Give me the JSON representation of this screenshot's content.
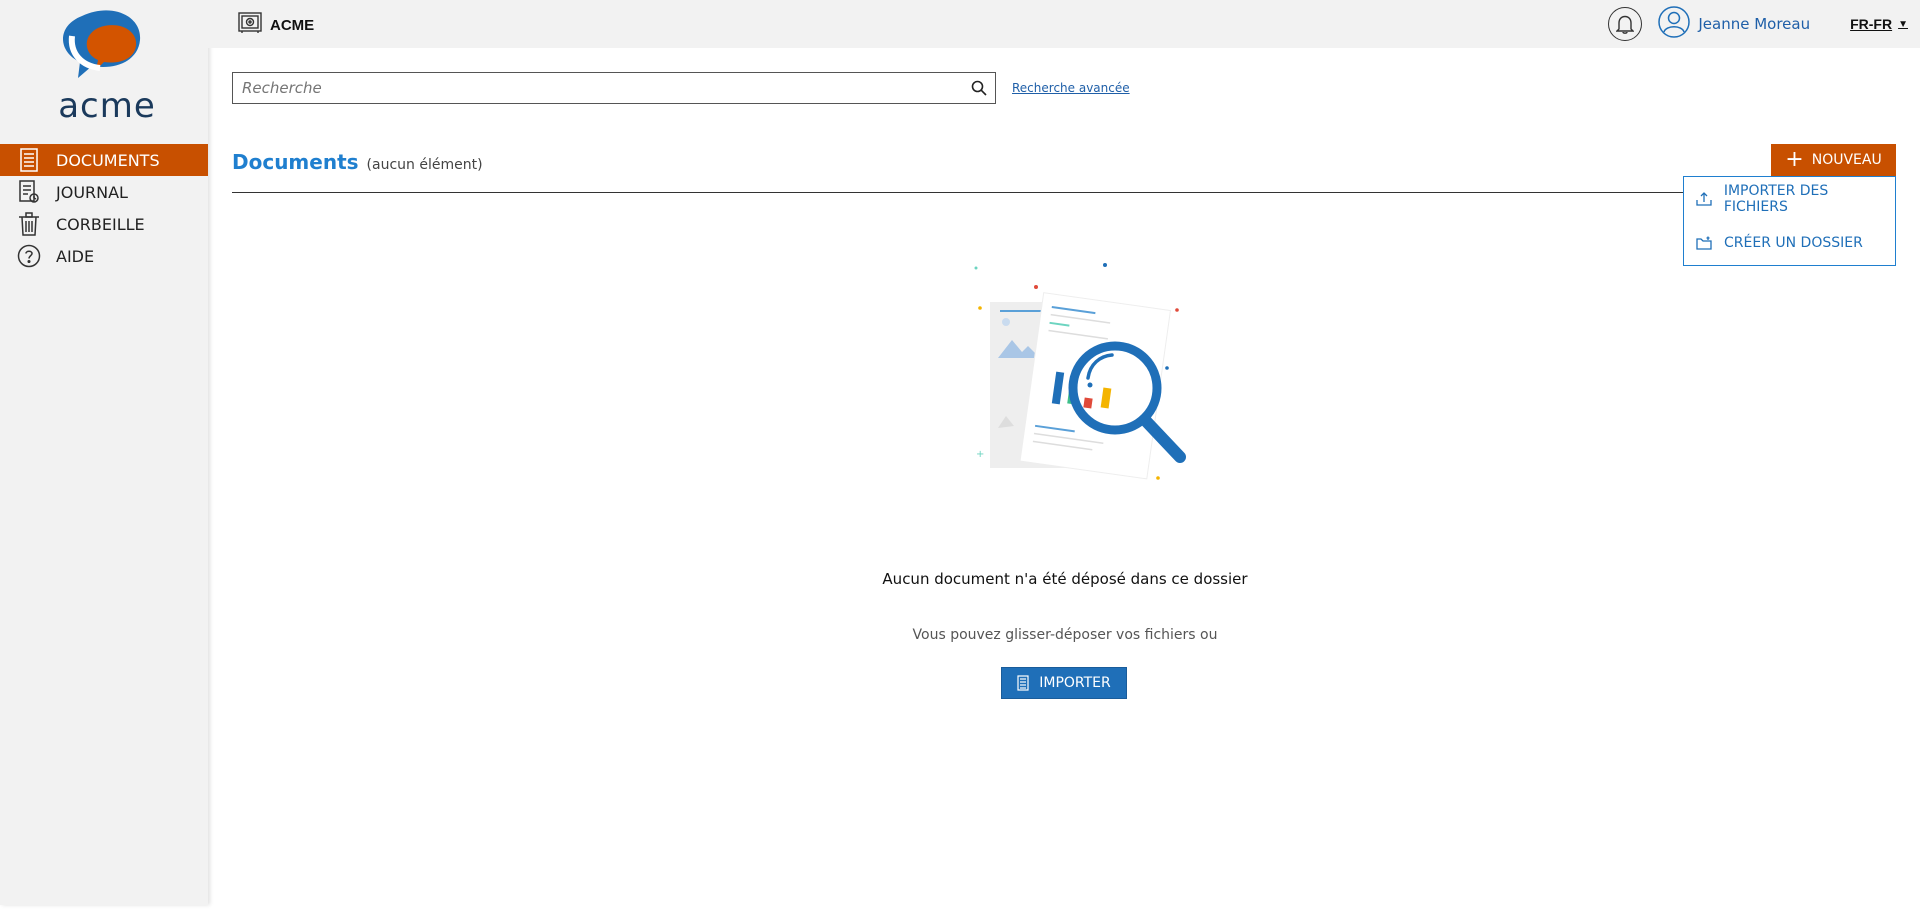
{
  "colors": {
    "accent": "#c85000",
    "primary": "#1f6fb8",
    "title": "#1f7fcf",
    "sidebar_bg": "#f2f2f2"
  },
  "logo": {
    "text": "acme"
  },
  "sidebar": {
    "items": [
      {
        "label": "DOCUMENTS",
        "icon": "document-list-icon",
        "active": true
      },
      {
        "label": "JOURNAL",
        "icon": "journal-icon",
        "active": false
      },
      {
        "label": "CORBEILLE",
        "icon": "trash-icon",
        "active": false
      },
      {
        "label": "AIDE",
        "icon": "help-icon",
        "active": false
      }
    ]
  },
  "header": {
    "brand": "ACME",
    "brand_icon": "safe-icon",
    "notifications_icon": "bell-icon",
    "user_name": "Jeanne Moreau",
    "language": "FR-FR"
  },
  "search": {
    "placeholder": "Recherche",
    "value": "",
    "advanced_link": "Recherche avancée"
  },
  "main": {
    "title": "Documents",
    "count_text": "(aucun élément)",
    "new_button": "NOUVEAU",
    "new_menu": [
      {
        "label": "IMPORTER DES FICHIERS",
        "icon": "upload-icon"
      },
      {
        "label": "CRÉER UN DOSSIER",
        "icon": "new-folder-icon"
      }
    ],
    "empty": {
      "illustration": "empty-search-illustration",
      "message": "Aucun document n'a été déposé dans ce dossier",
      "hint": "Vous pouvez glisser-déposer vos fichiers ou",
      "import_button": "IMPORTER"
    }
  }
}
